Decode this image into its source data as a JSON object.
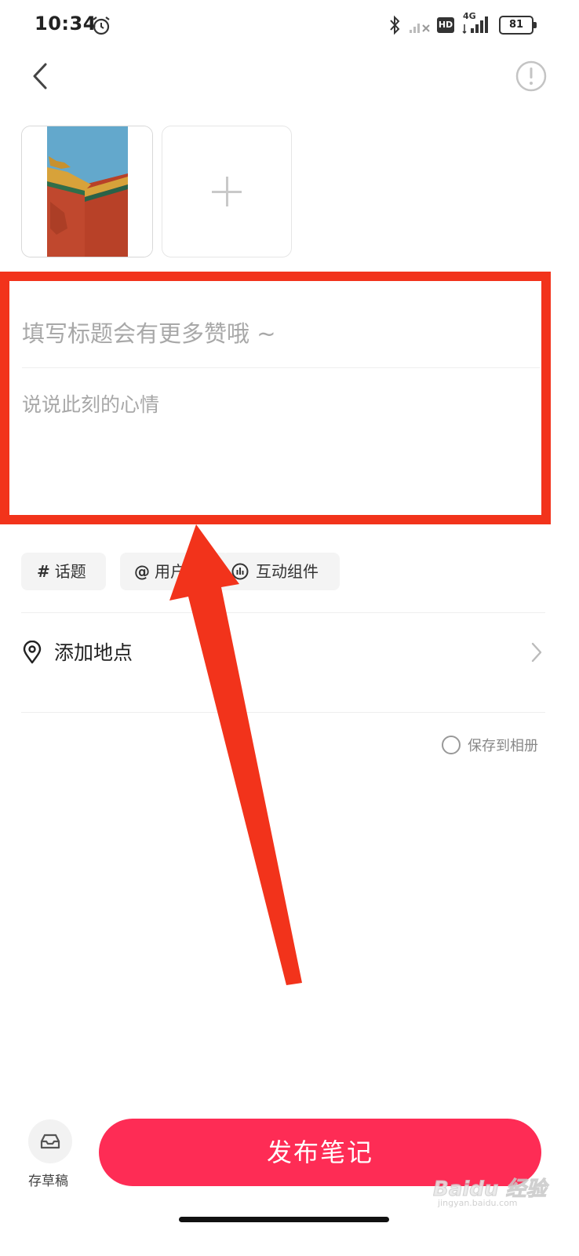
{
  "status_bar": {
    "time": "10:34",
    "hd_badge": "HD",
    "network": "4G",
    "battery": "81"
  },
  "editor": {
    "title_placeholder": "填写标题会有更多赞哦 ~",
    "content_placeholder": "说说此刻的心情"
  },
  "chips": [
    {
      "icon": "#",
      "label": "话题"
    },
    {
      "icon": "@",
      "label": "用户"
    },
    {
      "icon": "widget-icon",
      "label": "互动组件"
    }
  ],
  "location": {
    "label": "添加地点"
  },
  "save_to_album": {
    "label": "保存到相册",
    "checked": false
  },
  "bottom": {
    "draft_label": "存草稿",
    "publish_label": "发布笔记"
  },
  "watermark": {
    "brand": "Baidu 经验",
    "url": "jingyan.baidu.com"
  },
  "colors": {
    "publish": "#fe2c55",
    "annotation": "#f2331b"
  }
}
